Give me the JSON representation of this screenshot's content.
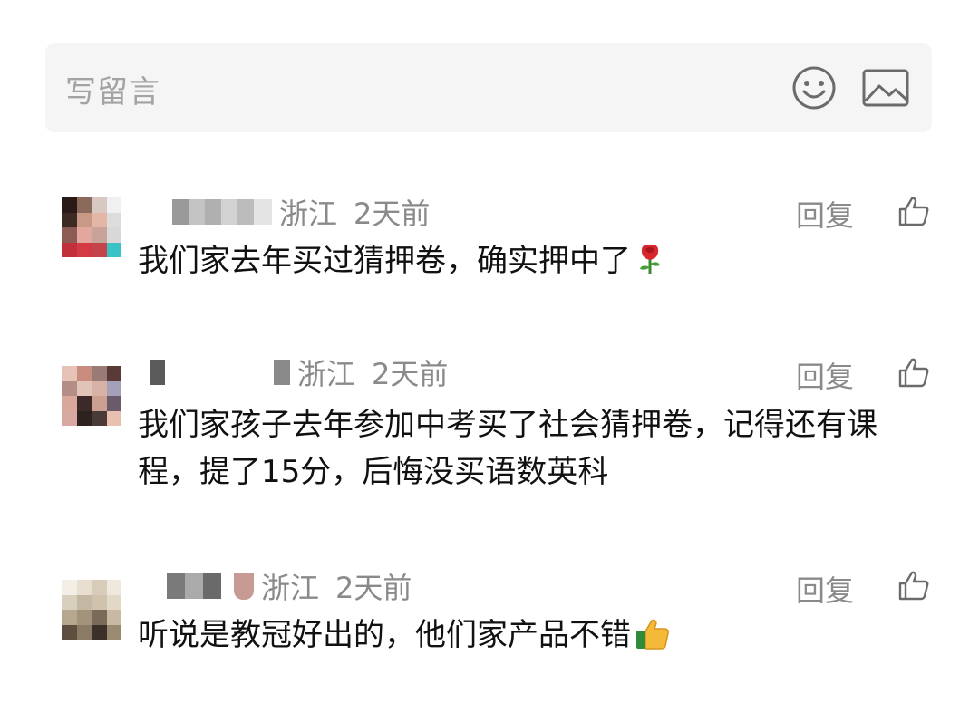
{
  "composer": {
    "placeholder": "写留言",
    "emoji_icon": "smiley-face-icon",
    "image_icon": "image-picture-icon"
  },
  "comments": [
    {
      "location": "浙江",
      "time": "2天前",
      "reply_label": "回复",
      "like_icon": "thumbs-up-outline-icon",
      "text": "我们家去年买过猜押卷，确实押中了",
      "trailing_emoji": "rose-emoji"
    },
    {
      "location": "浙江",
      "time": "2天前",
      "reply_label": "回复",
      "like_icon": "thumbs-up-outline-icon",
      "text": "我们家孩子去年参加中考买了社会猜押卷，记得还有课程，提了15分，后悔没买语数英科"
    },
    {
      "location": "浙江",
      "time": "2天前",
      "reply_label": "回复",
      "like_icon": "thumbs-up-outline-icon",
      "text": "听说是教冠好出的，他们家产品不错",
      "trailing_emoji": "thumbs-up-emoji"
    }
  ],
  "colors": {
    "composer_bg": "#f5f5f5",
    "meta_text": "#8a8a8a",
    "body_text": "#111111"
  }
}
